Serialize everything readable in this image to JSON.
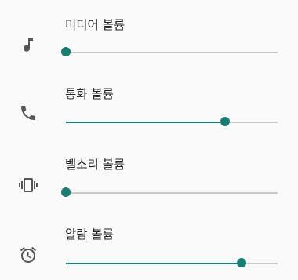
{
  "accent_color": "#1b7d72",
  "volume_settings": [
    {
      "label": "미디어 볼륨",
      "icon": "music-note-icon",
      "level": 0.0
    },
    {
      "label": "통화 볼륨",
      "icon": "phone-icon",
      "level": 0.75
    },
    {
      "label": "벨소리 볼륨",
      "icon": "vibrate-icon",
      "level": 0.0
    },
    {
      "label": "알람 볼륨",
      "icon": "alarm-clock-icon",
      "level": 0.83
    }
  ]
}
